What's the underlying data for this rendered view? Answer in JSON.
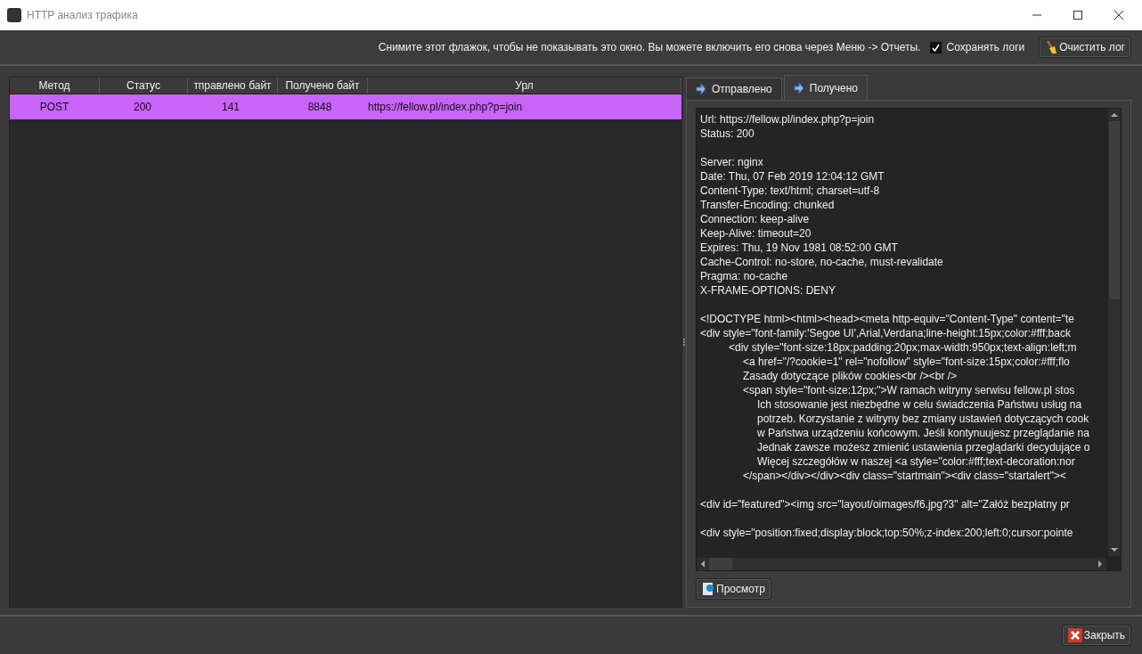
{
  "window": {
    "title": "HTTP анализ трафика"
  },
  "toolbar": {
    "hint": "Снимите этот флажок, чтобы не показывать это окно. Вы можете включить его снова через Меню -> Отчеты.",
    "save_logs": {
      "label": "Сохранять логи",
      "checked": true
    },
    "clear_button": "Очистить лог"
  },
  "table": {
    "columns": [
      "Метод",
      "Статус",
      "тправлено байт",
      "Получено байт",
      "Урл"
    ],
    "rows": [
      {
        "cells": [
          "POST",
          "200",
          "141",
          "8848",
          "https://fellow.pl/index.php?p=join"
        ],
        "selected": true
      }
    ]
  },
  "tabs": [
    {
      "label": "Отправлено",
      "selected": false
    },
    {
      "label": "Получено",
      "selected": true
    }
  ],
  "response": {
    "blocks": [
      [
        {
          "text": "Url: https://fellow.pl/index.php?p=join"
        },
        {
          "text": "Status: 200"
        }
      ],
      [
        {
          "text": "Server: nginx"
        },
        {
          "text": "Date: Thu, 07 Feb 2019 12:04:12 GMT"
        },
        {
          "text": "Content-Type: text/html; charset=utf-8"
        },
        {
          "text": "Transfer-Encoding: chunked"
        },
        {
          "text": "Connection: keep-alive"
        },
        {
          "text": "Keep-Alive: timeout=20"
        },
        {
          "text": "Expires: Thu, 19 Nov 1981 08:52:00 GMT"
        },
        {
          "text": "Cache-Control: no-store, no-cache, must-revalidate"
        },
        {
          "text": "Pragma: no-cache"
        },
        {
          "text": "X-FRAME-OPTIONS: DENY"
        }
      ],
      [
        {
          "text": "<!DOCTYPE html><html><head><meta http-equiv=\"Content-Type\" content=\"te"
        },
        {
          "text": "<div style=\"font-family:'Segoe UI',Arial,Verdana;line-height:15px;color:#fff;back",
          "children": [
            {
              "text": "<div style=\"font-size:18px;padding:20px;max-width:950px;text-align:left;m",
              "children": [
                {
                  "text": "<a href=\"/?cookie=1\" rel=\"nofollow\" style=\"font-size:15px;color:#fff;flo"
                },
                {
                  "text": "Zasady dotyczące plików cookies<br /><br />"
                },
                {
                  "text": "<span style=\"font-size:12px;\">W ramach witryny serwisu fellow.pl stos",
                  "children": [
                    {
                      "text": "Ich stosowanie jest niezbędne w celu świadczenia Państwu usług na"
                    },
                    {
                      "text": "potrzeb. Korzystanie z witryny bez zmiany ustawień dotyczących cook"
                    },
                    {
                      "text": "w Państwa urządzeniu końcowym. Jeśli kontynuujesz przeglądanie na"
                    },
                    {
                      "text": "Jednak zawsze możesz zmienić ustawienia przeglądarki decydujące o"
                    },
                    {
                      "text": "Więcej szczegółów w naszej <a style=\"color:#fff;text-decoration:nor"
                    }
                  ]
                },
                {
                  "text": "</span></div></div><div class=\"startmain\"><div class=\"startalert\"><"
                }
              ]
            }
          ]
        }
      ],
      [
        {
          "text": "<div id=\"featured\"><img src=\"layout/oimages/f6.jpg?3\" alt=\"Załóż bezpłatny pr"
        }
      ],
      [
        {
          "text": "<div style=\"position:fixed;display:block;top:50%;z-index:200;left:0;cursor:pointe"
        }
      ]
    ]
  },
  "preview_button": "Просмотр",
  "close_button": "Закрыть"
}
